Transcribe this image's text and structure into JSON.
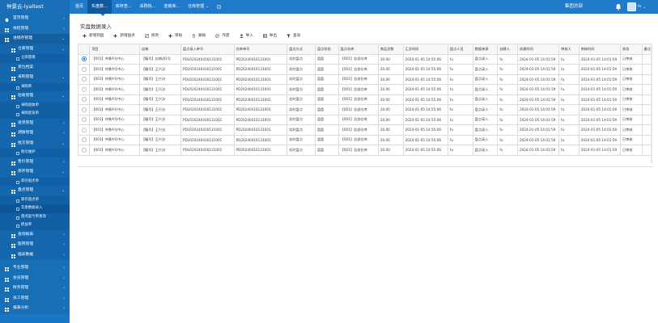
{
  "app": {
    "brand": "仲景云-lyaltest"
  },
  "topnav": [
    {
      "label": "首页",
      "active": false,
      "chevron": false
    },
    {
      "label": "实盘数...",
      "active": true,
      "chevron": false
    },
    {
      "label": "库存查...",
      "active": false,
      "chevron": false
    },
    {
      "label": "采购批...",
      "active": false,
      "chevron": false
    },
    {
      "label": "连锁库...",
      "active": false,
      "chevron": false
    },
    {
      "label": "仓库管理",
      "active": false,
      "chevron": true
    }
  ],
  "header": {
    "org": "集团总部",
    "user": "fe"
  },
  "sidebar": [
    {
      "label": "首页管理",
      "level": 1,
      "arrow": "‹",
      "icon": "home"
    },
    {
      "label": "体检管理",
      "level": 1,
      "arrow": "‹",
      "icon": "grid"
    },
    {
      "label": "进销存管理",
      "level": 1,
      "arrow": "⌄",
      "open": true,
      "icon": "grid"
    },
    {
      "label": "仓库管理",
      "level": 2,
      "arrow": "⌄",
      "icon": "grid"
    },
    {
      "label": "仓库管理",
      "level": 3
    },
    {
      "label": "货位档案",
      "level": 2,
      "icon": "grid"
    },
    {
      "label": "采购管理",
      "level": 2,
      "arrow": "⌄",
      "icon": "grid"
    },
    {
      "label": "采购单",
      "level": 3
    },
    {
      "label": "验收管理",
      "level": 2,
      "arrow": "⌄",
      "icon": "grid"
    },
    {
      "label": "采购验收单",
      "level": 3
    },
    {
      "label": "采购退货单",
      "level": 3
    },
    {
      "label": "退货管理",
      "level": 2,
      "arrow": "‹",
      "icon": "grid"
    },
    {
      "label": "调拨管理",
      "level": 2,
      "arrow": "‹",
      "icon": "grid"
    },
    {
      "label": "批次管理",
      "level": 2,
      "arrow": "⌄",
      "icon": "grid"
    },
    {
      "label": "批号维护",
      "level": 3
    },
    {
      "label": "售价管理",
      "level": 2,
      "arrow": "‹",
      "icon": "grid"
    },
    {
      "label": "库存管理",
      "level": 2,
      "arrow": "⌄",
      "icon": "grid"
    },
    {
      "label": "库存盘点单",
      "level": 3
    },
    {
      "label": "盘点管理",
      "level": 2,
      "arrow": "⌄",
      "icon": "grid"
    },
    {
      "label": "库存盘点单",
      "level": 3
    },
    {
      "label": "实盘数据录入",
      "level": 3,
      "active": true
    },
    {
      "label": "盘点盈亏单查询",
      "level": 3
    },
    {
      "label": "损益单",
      "level": 3
    },
    {
      "label": "查询报表",
      "level": 2,
      "arrow": "‹",
      "icon": "grid"
    },
    {
      "label": "医院管理",
      "level": 2,
      "arrow": "‹",
      "icon": "grid"
    },
    {
      "label": "临床数据",
      "level": 2,
      "arrow": "‹",
      "icon": "grid"
    },
    {
      "gap": true
    },
    {
      "label": "专业管理",
      "level": 1,
      "arrow": "‹",
      "icon": "grid"
    },
    {
      "label": "会员管理",
      "level": 1,
      "arrow": "‹",
      "icon": "grid"
    },
    {
      "label": "财务管理",
      "level": 1,
      "arrow": "‹",
      "icon": "grid"
    },
    {
      "label": "员工管理",
      "level": 1,
      "arrow": "‹",
      "icon": "grid"
    },
    {
      "label": "报表分析",
      "level": 1,
      "arrow": "‹",
      "icon": "grid"
    }
  ],
  "page": {
    "title": "实盘数据录入"
  },
  "toolbar": [
    {
      "label": "新增到盘",
      "icon": "plus-icon"
    },
    {
      "label": "新增盘点",
      "icon": "plus-icon"
    },
    {
      "label": "修改",
      "icon": "edit-icon"
    },
    {
      "label": "审核",
      "icon": "plus-icon"
    },
    {
      "label": "删除",
      "icon": "trash-icon"
    },
    {
      "label": "作废",
      "icon": "ban-icon"
    },
    {
      "label": "导入",
      "icon": "user-icon"
    },
    {
      "label": "导出",
      "icon": "table-icon"
    },
    {
      "label": "查询",
      "icon": "filter-icon"
    }
  ],
  "table": {
    "columns": [
      "",
      "项目",
      "店铺",
      "盘点录入单号",
      "仓库单号",
      "盘点方式",
      "盘点状态",
      "盘点仓库",
      "商品总数",
      "汇总时间",
      "盘点人员",
      "数据来源",
      "创建人",
      "创建时间",
      "审核人",
      "审核时间",
      "状态",
      "备注"
    ],
    "rows": [
      [
        "",
        "【001】仲景A号中心",
        "【编号】店铺进1号",
        "PDLR20240416131001",
        "PD20240416131001",
        "实时盘点",
        "盘盈",
        "【001】总部仓库",
        "20.00",
        "2024-01-05 14:55:06",
        "fu",
        "盘点录入",
        "fu",
        "2024-01-05 14:01:59",
        "fu",
        "2024-01-05 14:01:59",
        "已审核",
        ""
      ],
      [
        "",
        "【001】仲景A号中心",
        "【编号】王兴治",
        "PDLR20240416131001",
        "PD20240416131001",
        "实时盘点",
        "盘盈",
        "【001】总部仓库",
        "20.00",
        "2024-01-05 14:55:06",
        "fu",
        "盘点录入",
        "fu",
        "2024-01-05 14:01:59",
        "fu",
        "2024-01-05 14:01:59",
        "已审核",
        ""
      ],
      [
        "",
        "【001】仲景A号中心",
        "【编号】王兴治",
        "PDLR20240416131001",
        "PD20240416131001",
        "实时盘点",
        "盘盈",
        "【001】总部仓库",
        "20.00",
        "2024-01-05 14:55:06",
        "fu",
        "盘点录入",
        "fu",
        "2024-01-05 14:01:59",
        "fu",
        "2024-01-05 14:01:59",
        "已审核",
        ""
      ],
      [
        "",
        "【001】仲景A号中心",
        "【编号】王兴治",
        "PDLR20240416131001",
        "PD20240416131001",
        "实时盘点",
        "盘盈",
        "【001】总部仓库",
        "20.00",
        "2024-01-05 14:55:06",
        "fu",
        "盘点录入",
        "fu",
        "2024-01-05 14:01:59",
        "fu",
        "2024-01-05 14:01:59",
        "已审核",
        ""
      ],
      [
        "",
        "【001】仲景A号中心",
        "【编号】王兴治",
        "PDLR20240416131001",
        "PD20240416131001",
        "实时盘点",
        "盘盈",
        "【001】总部仓库",
        "20.00",
        "2024-01-05 14:55:06",
        "fu",
        "盘点录入",
        "fu",
        "2024-01-05 14:01:59",
        "fu",
        "2024-01-05 14:01:59",
        "已审核",
        ""
      ],
      [
        "",
        "【001】仲景A号中心",
        "【编号】王兴治",
        "PDLR20240416131001",
        "PD20240416131001",
        "实时盘点",
        "盘盈",
        "【001】总部仓库",
        "20.00",
        "2024-01-05 14:55:06",
        "fu",
        "盘点录入",
        "fu",
        "2024-01-05 14:01:59",
        "fu",
        "2024-01-05 14:01:59",
        "已审核",
        ""
      ],
      [
        "",
        "【001】仲景A号中心",
        "【编号】王兴治",
        "PDLR20240416131001",
        "PD20240416131001",
        "实时盘点",
        "盘盈",
        "【001】总部仓库",
        "20.00",
        "2024-01-05 14:55:06",
        "fu",
        "盘点录入",
        "fu",
        "2024-01-05 14:01:59",
        "fu",
        "2024-01-05 14:01:59",
        "已审核",
        ""
      ],
      [
        "",
        "【001】仲景A号中心",
        "【编号】王兴治",
        "PDLR20240416131001",
        "PD20240416131001",
        "实时盘点",
        "盘盈",
        "【001】总部仓库",
        "20.00",
        "2024-01-05 14:55:06",
        "fu",
        "盘点录入",
        "fu",
        "2024-01-05 14:01:59",
        "fu",
        "2024-01-05 14:01:59",
        "已审核",
        ""
      ],
      [
        "",
        "【001】仲景A号中心",
        "【编号】王兴治",
        "PDLR20240416131001",
        "PD20240416131001",
        "实时盘点",
        "盘盈",
        "【001】总部仓库",
        "20.00",
        "2024-01-05 14:55:06",
        "fu",
        "盘点录入",
        "fu",
        "2024-01-05 14:01:59",
        "fu",
        "2024-01-05 14:01:59",
        "已审核",
        ""
      ],
      [
        "",
        "【001】仲景A号中心",
        "【编号】王兴治",
        "PDLR20240416131001",
        "PD20240416131001",
        "实时盘点",
        "盘盈",
        "【001】总部仓库",
        "20.00",
        "2024-01-05 14:55:06",
        "fu",
        "盘点录入",
        "fu",
        "2024-01-05 14:01:59",
        "fu",
        "2024-01-05 14:01:59",
        "已审核",
        ""
      ]
    ],
    "selected_row": 0
  },
  "colors": {
    "primary": "#1f7ac9",
    "sidebar": "#1976c4",
    "sidebar_active": "#0c5596"
  }
}
